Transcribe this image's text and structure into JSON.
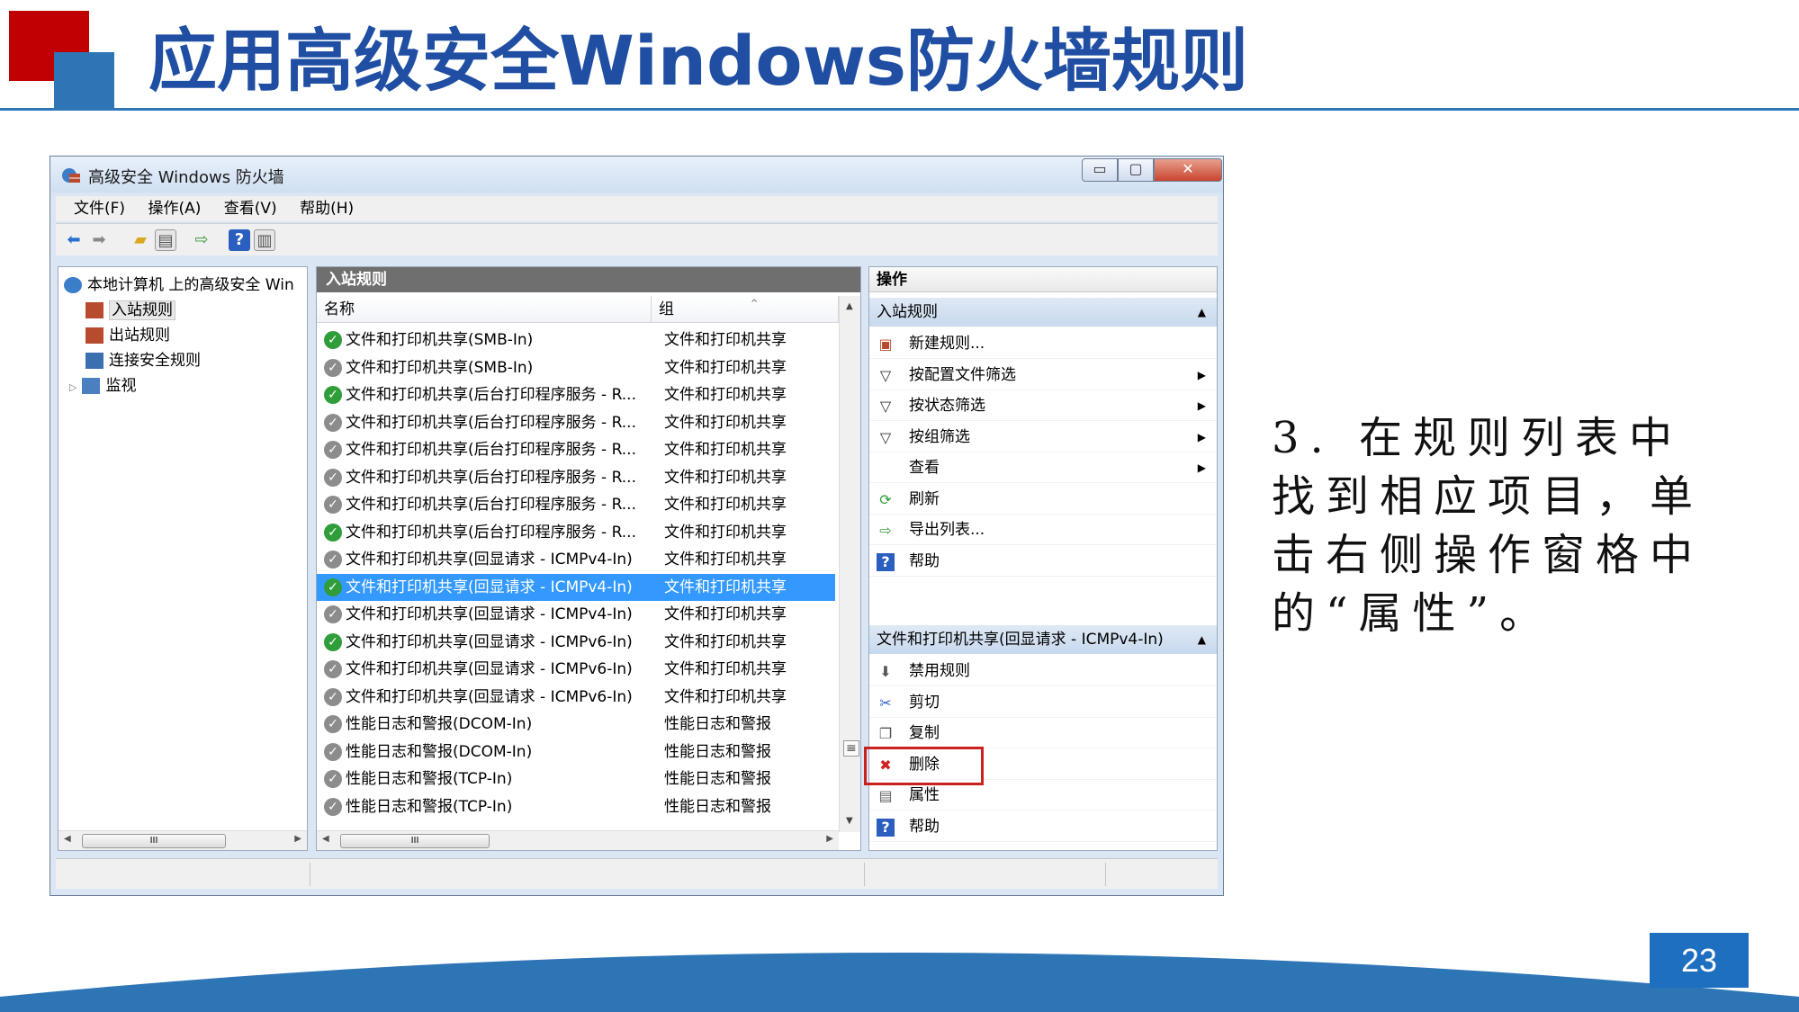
{
  "slide": {
    "title": "应用高级安全Windows防火墙规则",
    "instruction": "3. 在规则列表中找到相应项目，单击右侧操作窗格中的“属性”。",
    "page_number": "23",
    "colors": {
      "title": "#1f4ea3",
      "accent_red": "#c00000",
      "accent_blue": "#2e75b6",
      "highlight_box": "#c9211e"
    }
  },
  "window": {
    "title": "高级安全 Windows 防火墙",
    "menu": [
      "文件(F)",
      "操作(A)",
      "查看(V)",
      "帮助(H)"
    ],
    "toolbar_icons": [
      "back-arrow-icon",
      "forward-arrow-icon",
      "folder-up-icon",
      "show-hide-console-tree-icon",
      "export-list-icon",
      "help-icon",
      "show-hide-action-pane-icon"
    ]
  },
  "tree": {
    "root": "本地计算机 上的高级安全 Win",
    "items": [
      "入站规则",
      "出站规则",
      "连接安全规则",
      "监视"
    ],
    "selected": "入站规则"
  },
  "list": {
    "header": "入站规则",
    "columns": [
      "名称",
      "组"
    ],
    "rows": [
      {
        "name": "文件和打印机共享(SMB-In)",
        "group": "文件和打印机共享",
        "enabled": true
      },
      {
        "name": "文件和打印机共享(SMB-In)",
        "group": "文件和打印机共享",
        "enabled": false
      },
      {
        "name": "文件和打印机共享(后台打印程序服务 - R...",
        "group": "文件和打印机共享",
        "enabled": true
      },
      {
        "name": "文件和打印机共享(后台打印程序服务 - R...",
        "group": "文件和打印机共享",
        "enabled": false
      },
      {
        "name": "文件和打印机共享(后台打印程序服务 - R...",
        "group": "文件和打印机共享",
        "enabled": false
      },
      {
        "name": "文件和打印机共享(后台打印程序服务 - R...",
        "group": "文件和打印机共享",
        "enabled": false
      },
      {
        "name": "文件和打印机共享(后台打印程序服务 - R...",
        "group": "文件和打印机共享",
        "enabled": false
      },
      {
        "name": "文件和打印机共享(后台打印程序服务 - R...",
        "group": "文件和打印机共享",
        "enabled": true
      },
      {
        "name": "文件和打印机共享(回显请求 - ICMPv4-In)",
        "group": "文件和打印机共享",
        "enabled": false
      },
      {
        "name": "文件和打印机共享(回显请求 - ICMPv4-In)",
        "group": "文件和打印机共享",
        "enabled": true,
        "selected": true
      },
      {
        "name": "文件和打印机共享(回显请求 - ICMPv4-In)",
        "group": "文件和打印机共享",
        "enabled": false
      },
      {
        "name": "文件和打印机共享(回显请求 - ICMPv6-In)",
        "group": "文件和打印机共享",
        "enabled": true
      },
      {
        "name": "文件和打印机共享(回显请求 - ICMPv6-In)",
        "group": "文件和打印机共享",
        "enabled": false
      },
      {
        "name": "文件和打印机共享(回显请求 - ICMPv6-In)",
        "group": "文件和打印机共享",
        "enabled": false
      },
      {
        "name": "性能日志和警报(DCOM-In)",
        "group": "性能日志和警报",
        "enabled": false
      },
      {
        "name": "性能日志和警报(DCOM-In)",
        "group": "性能日志和警报",
        "enabled": false
      },
      {
        "name": "性能日志和警报(TCP-In)",
        "group": "性能日志和警报",
        "enabled": false
      },
      {
        "name": "性能日志和警报(TCP-In)",
        "group": "性能日志和警报",
        "enabled": false
      }
    ]
  },
  "actions": {
    "title": "操作",
    "section1": {
      "label": "入站规则",
      "items": [
        {
          "label": "新建规则...",
          "icon": "new-rule-icon",
          "submenu": false
        },
        {
          "label": "按配置文件筛选",
          "icon": "filter-icon",
          "submenu": true
        },
        {
          "label": "按状态筛选",
          "icon": "filter-icon",
          "submenu": true
        },
        {
          "label": "按组筛选",
          "icon": "filter-icon",
          "submenu": true
        },
        {
          "label": "查看",
          "icon": "",
          "submenu": true
        },
        {
          "label": "刷新",
          "icon": "refresh-icon",
          "submenu": false
        },
        {
          "label": "导出列表...",
          "icon": "export-icon",
          "submenu": false
        },
        {
          "label": "帮助",
          "icon": "help-icon",
          "submenu": false
        }
      ]
    },
    "section2": {
      "label": "文件和打印机共享(回显请求 - ICMPv4-In)",
      "items": [
        {
          "label": "禁用规则",
          "icon": "disable-icon"
        },
        {
          "label": "剪切",
          "icon": "cut-icon"
        },
        {
          "label": "复制",
          "icon": "copy-icon"
        },
        {
          "label": "删除",
          "icon": "delete-icon"
        },
        {
          "label": "属性",
          "icon": "properties-icon",
          "highlighted": true
        },
        {
          "label": "帮助",
          "icon": "help-icon"
        }
      ]
    }
  }
}
